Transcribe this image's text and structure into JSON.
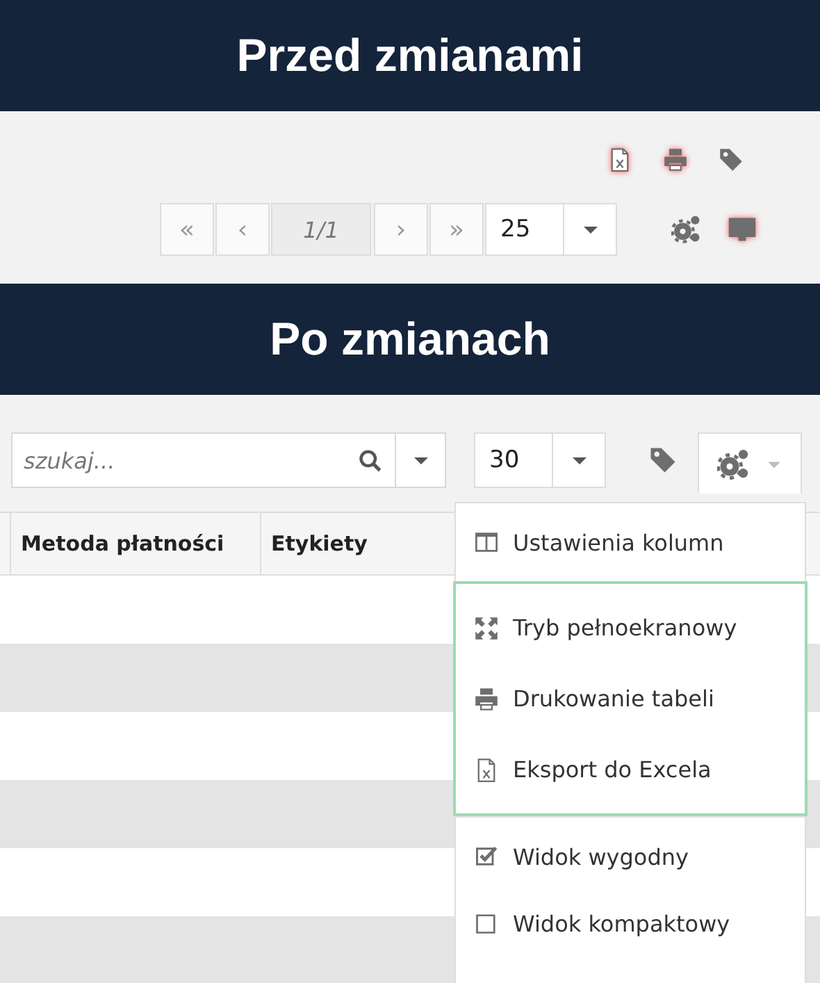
{
  "before": {
    "title": "Przed zmianami",
    "icons": [
      {
        "kind": "excel",
        "highlighted": true
      },
      {
        "kind": "print",
        "highlighted": true
      },
      {
        "kind": "tag",
        "highlighted": false
      }
    ],
    "pager": {
      "buttons": [
        {
          "label": "«"
        },
        {
          "label": "‹"
        }
      ],
      "page": "1/1",
      "next_buttons": [
        {
          "label": "›"
        },
        {
          "label": "»"
        }
      ],
      "page_size": "25"
    },
    "tools": [
      {
        "kind": "gears",
        "highlighted": false
      },
      {
        "kind": "monitor",
        "highlighted": true
      }
    ]
  },
  "after": {
    "title": "Po zmianach",
    "search": {
      "placeholder": "szukaj..."
    },
    "page_size": "30",
    "table": {
      "columns": [
        "Metoda płatności",
        "Etykiety"
      ]
    },
    "menu": {
      "sections": [
        {
          "highlighted": false,
          "items": [
            {
              "kind": "columns",
              "label": "Ustawienia kolumn"
            }
          ]
        },
        {
          "highlighted": true,
          "items": [
            {
              "kind": "fullscreen",
              "label": "Tryb pełnoekranowy"
            },
            {
              "kind": "print",
              "label": "Drukowanie tabeli"
            },
            {
              "kind": "excel",
              "label": "Eksport do Excela"
            }
          ]
        },
        {
          "highlighted": false,
          "items": [
            {
              "kind": "checkbox",
              "label": "Widok wygodny",
              "checked": true
            },
            {
              "kind": "checkbox",
              "label": "Widok kompaktowy",
              "checked": false
            }
          ]
        }
      ]
    }
  }
}
